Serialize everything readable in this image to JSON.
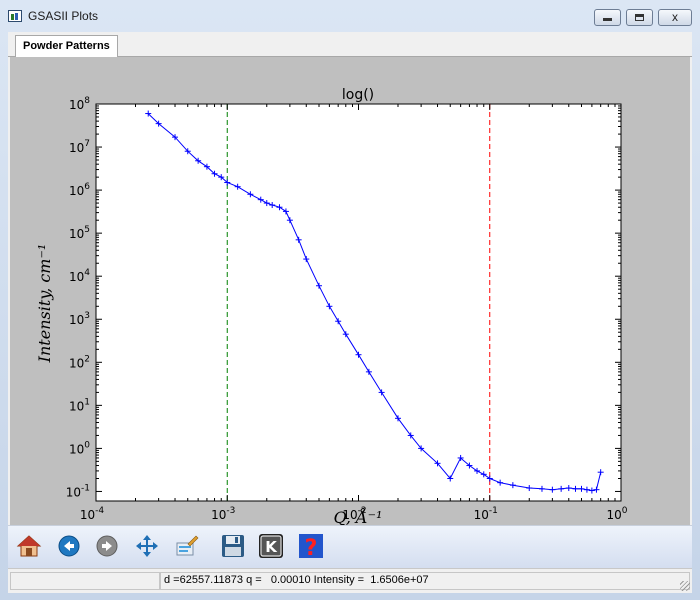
{
  "window": {
    "title": "GSASII Plots",
    "min_label": "",
    "max_label": "",
    "close_label": "x"
  },
  "tabs": [
    {
      "label": "Powder Patterns",
      "active": true
    }
  ],
  "colors": {
    "series": "#0000ff",
    "marker_low": "#008000",
    "marker_high": "#ff0000",
    "axes_bg": "#ffffff",
    "panel_bg": "#bfbfbf"
  },
  "chart_data": {
    "type": "line",
    "title": "log()",
    "xlabel": "Q, Å⁻¹",
    "ylabel": "Intensity, cm⁻¹",
    "xscale": "log",
    "yscale": "log",
    "xlim": [
      0.0001,
      1
    ],
    "ylim": [
      0.06,
      100000000
    ],
    "grid": false,
    "x_ticks": [
      {
        "value": 0.0001,
        "base": "10",
        "exp": "-4"
      },
      {
        "value": 0.001,
        "base": "10",
        "exp": "-3"
      },
      {
        "value": 0.01,
        "base": "10",
        "exp": "-2"
      },
      {
        "value": 0.1,
        "base": "10",
        "exp": "-1"
      },
      {
        "value": 1,
        "base": "10",
        "exp": "0"
      }
    ],
    "y_ticks": [
      {
        "value": 0.1,
        "base": "10",
        "exp": "-1"
      },
      {
        "value": 1,
        "base": "10",
        "exp": "0"
      },
      {
        "value": 10,
        "base": "10",
        "exp": "1"
      },
      {
        "value": 100,
        "base": "10",
        "exp": "2"
      },
      {
        "value": 1000,
        "base": "10",
        "exp": "3"
      },
      {
        "value": 10000,
        "base": "10",
        "exp": "4"
      },
      {
        "value": 100000,
        "base": "10",
        "exp": "5"
      },
      {
        "value": 1000000,
        "base": "10",
        "exp": "6"
      },
      {
        "value": 10000000,
        "base": "10",
        "exp": "7"
      },
      {
        "value": 100000000,
        "base": "10",
        "exp": "8"
      }
    ],
    "vlines": [
      {
        "x": 0.001,
        "color": "#008000",
        "style": "dashed"
      },
      {
        "x": 0.1,
        "color": "#ff0000",
        "style": "dashed"
      }
    ],
    "series": [
      {
        "color": "#0000ff",
        "errorbars": true,
        "x": [
          0.00025,
          0.0003,
          0.0004,
          0.0005,
          0.0006,
          0.0007,
          0.0008,
          0.0009,
          0.001,
          0.0012,
          0.0015,
          0.0018,
          0.002,
          0.0022,
          0.0025,
          0.0028,
          0.003,
          0.0035,
          0.004,
          0.005,
          0.006,
          0.007,
          0.008,
          0.01,
          0.012,
          0.015,
          0.02,
          0.025,
          0.03,
          0.04,
          0.05,
          0.06,
          0.07,
          0.08,
          0.09,
          0.1,
          0.12,
          0.15,
          0.2,
          0.25,
          0.3,
          0.35,
          0.4,
          0.45,
          0.5,
          0.55,
          0.6,
          0.65,
          0.7
        ],
        "y": [
          60000000,
          35000000,
          17000000,
          8000000,
          4800000,
          3500000,
          2400000,
          2000000,
          1500000,
          1200000,
          800000,
          600000,
          500000,
          450000,
          400000,
          320000,
          200000,
          70000,
          25000,
          6000,
          2000,
          900,
          450,
          150,
          60,
          20,
          5,
          2,
          1,
          0.45,
          0.2,
          0.6,
          0.4,
          0.3,
          0.25,
          0.2,
          0.16,
          0.14,
          0.12,
          0.115,
          0.11,
          0.115,
          0.12,
          0.115,
          0.115,
          0.11,
          0.105,
          0.11,
          0.28
        ]
      }
    ]
  },
  "toolbar": {
    "buttons": [
      {
        "name": "home-button",
        "icon": "home-icon"
      },
      {
        "name": "back-button",
        "icon": "back-arrow-icon"
      },
      {
        "name": "forward-button",
        "icon": "forward-arrow-icon"
      },
      {
        "name": "pan-button",
        "icon": "pan-arrows-icon"
      },
      {
        "name": "configure-subplots-button",
        "icon": "configure-icon"
      },
      {
        "name": "save-button",
        "icon": "floppy-disk-icon"
      },
      {
        "name": "key-press-button",
        "icon": "k-key-icon"
      },
      {
        "name": "help-button",
        "icon": "question-mark-icon"
      }
    ]
  },
  "status": {
    "readout": "d =62557.11873 q =   0.00010 Intensity =  1.6506e+07"
  }
}
